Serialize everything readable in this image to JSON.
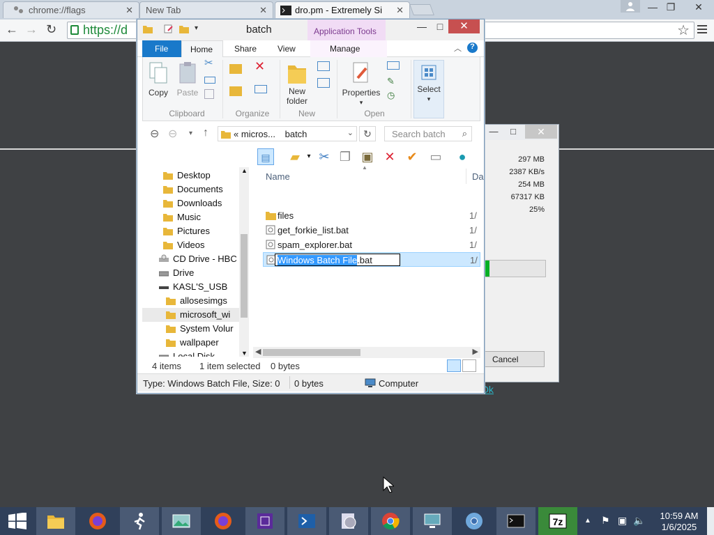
{
  "browser": {
    "tabs": [
      {
        "title": "chrome://flags",
        "close": "✕"
      },
      {
        "title": "New Tab",
        "close": "✕"
      },
      {
        "title": "dro.pm - Extremely Si",
        "close": "✕"
      }
    ],
    "url_visible": "https://d",
    "window_controls": {
      "minimize": "—",
      "restore": "❐",
      "close": "✕"
    }
  },
  "web_page": {
    "link_text": "Ok"
  },
  "progress_dialog": {
    "stats": [
      "297 MB",
      "2387 KB/s",
      "254 MB",
      "67317 KB",
      "25%"
    ],
    "progress": 0.07,
    "cancel_label": "Cancel"
  },
  "explorer": {
    "title": "batch",
    "contextual_tab": "Application Tools",
    "tabs": {
      "file": "File",
      "home": "Home",
      "share": "Share",
      "view": "View",
      "manage": "Manage"
    },
    "ribbon": {
      "copy": "Copy",
      "paste": "Paste",
      "new_folder_line1": "New",
      "new_folder_line2": "folder",
      "properties": "Properties",
      "select": "Select",
      "groups": {
        "clipboard": "Clipboard",
        "organize": "Organize",
        "new": "New",
        "open": "Open"
      }
    },
    "address": {
      "crumb_prefix": "«",
      "crumb_parent": "micros...",
      "crumb_current": "batch",
      "search_placeholder": "Search batch"
    },
    "nav_items": [
      {
        "label": "Desktop",
        "icon": "folder-icon"
      },
      {
        "label": "Documents",
        "icon": "folder-icon"
      },
      {
        "label": "Downloads",
        "icon": "folder-icon"
      },
      {
        "label": "Music",
        "icon": "folder-icon"
      },
      {
        "label": "Pictures",
        "icon": "folder-icon"
      },
      {
        "label": "Videos",
        "icon": "folder-icon"
      },
      {
        "label": "CD Drive - HBC",
        "icon": "cd-drive-icon"
      },
      {
        "label": "Drive",
        "icon": "drive-icon"
      },
      {
        "label": "KASL'S_USB",
        "icon": "usb-drive-icon"
      },
      {
        "label": "allosesimgs",
        "icon": "folder-icon"
      },
      {
        "label": "microsoft_wi",
        "icon": "folder-icon"
      },
      {
        "label": "System Volur",
        "icon": "folder-icon"
      },
      {
        "label": "wallpaper",
        "icon": "folder-icon"
      },
      {
        "label": "Local Disk",
        "icon": "drive-icon"
      }
    ],
    "columns": {
      "name": "Name",
      "date": "Da"
    },
    "files": [
      {
        "name": "files",
        "date": "1/",
        "icon": "folder-icon"
      },
      {
        "name": "get_forkie_list.bat",
        "date": "1/",
        "icon": "batch-file-icon"
      },
      {
        "name": "spam_explorer.bat",
        "date": "1/",
        "icon": "batch-file-icon"
      }
    ],
    "renaming": {
      "selected_part": "Windows Batch File",
      "extension": ".bat",
      "date": "1/"
    },
    "status": {
      "items": "4 items",
      "selected": "1 item selected",
      "size": "0 bytes"
    },
    "details": {
      "type": "Type: Windows Batch File, Size: 0",
      "size": "0 bytes",
      "location": "Computer"
    }
  },
  "taskbar": {
    "clock_time": "10:59 AM",
    "clock_date": "1/6/2025"
  }
}
